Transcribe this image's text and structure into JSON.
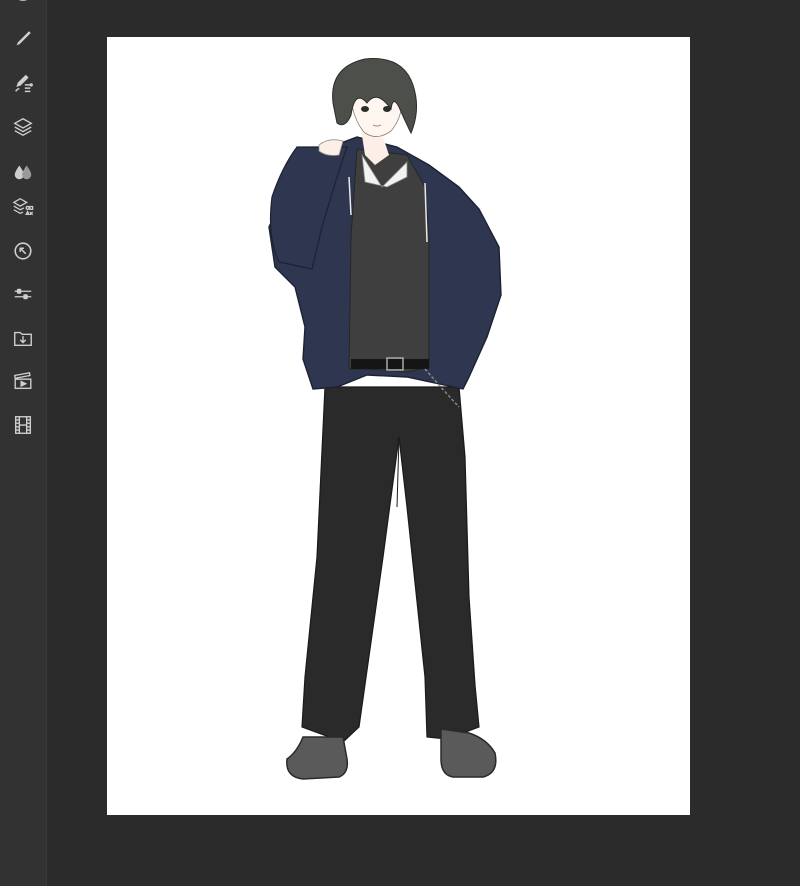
{
  "app": {
    "colors": {
      "toolbar_bg": "#323232",
      "workspace_bg": "#2b2b2b",
      "canvas_bg": "#ffffff",
      "icon": "#cfcfcf"
    }
  },
  "toolbar": {
    "tools": [
      {
        "icon": "partial-icon-top"
      },
      {
        "icon": "brush-icon"
      },
      {
        "icon": "brush-settings-icon"
      },
      {
        "icon": "layers-icon"
      },
      {
        "icon": "liquify-icon"
      },
      {
        "icon": "layer-adjustments-icon"
      },
      {
        "icon": "transform-rotate-icon"
      },
      {
        "icon": "adjustments-sliders-icon"
      },
      {
        "icon": "import-folder-icon"
      },
      {
        "icon": "timelapse-video-icon"
      },
      {
        "icon": "animation-film-icon"
      }
    ]
  },
  "canvas": {
    "artwork": "anime-character-illustration"
  }
}
